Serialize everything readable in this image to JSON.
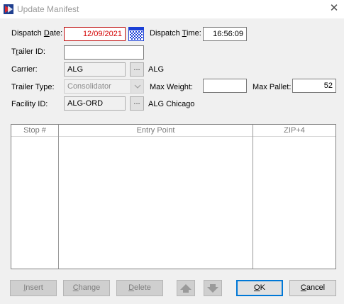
{
  "window": {
    "title": "Update Manifest",
    "close_glyph": "✕"
  },
  "form": {
    "dispatch_date": {
      "label_pre": "Dispatch ",
      "label_u": "D",
      "label_post": "ate:",
      "value": "12/09/2021"
    },
    "dispatch_time": {
      "label_pre": "Dispatch ",
      "label_u": "T",
      "label_post": "ime:",
      "value": "16:56:09"
    },
    "trailer_id": {
      "label_pre": "T",
      "label_u": "r",
      "label_post": "ailer ID:",
      "value": ""
    },
    "carrier": {
      "label": "Carrier:",
      "value": "ALG",
      "button": "...",
      "name": "ALG"
    },
    "trailer_type": {
      "label": "Trailer Type:",
      "value": "Consolidator"
    },
    "max_weight": {
      "label": "Max Weight:",
      "value": ""
    },
    "max_pallet": {
      "label": "Max Pallet:",
      "value": "52"
    },
    "facility_id": {
      "label": "Facility ID:",
      "value": "ALG-ORD",
      "button": "...",
      "name": "ALG Chicago"
    }
  },
  "grid": {
    "columns": [
      "Stop #",
      "Entry Point",
      "ZIP+4"
    ],
    "rows": []
  },
  "buttons": {
    "insert": {
      "u": "I",
      "rest": "nsert"
    },
    "change": {
      "u": "C",
      "rest": "hange"
    },
    "delete": {
      "u": "D",
      "rest": "elete"
    },
    "ok": {
      "u": "O",
      "rest": "K"
    },
    "cancel": {
      "u": "C",
      "rest": "ancel"
    }
  },
  "icons": {
    "app": "app-logo-icon",
    "calendar": "calendar-icon",
    "dropdown": "chevron-down-icon",
    "move_up": "arrow-up-icon",
    "move_down": "arrow-down-icon"
  },
  "colors": {
    "date_text": "#d40000",
    "calendar": "#1a3fd6",
    "ok_border": "#0078d7"
  }
}
